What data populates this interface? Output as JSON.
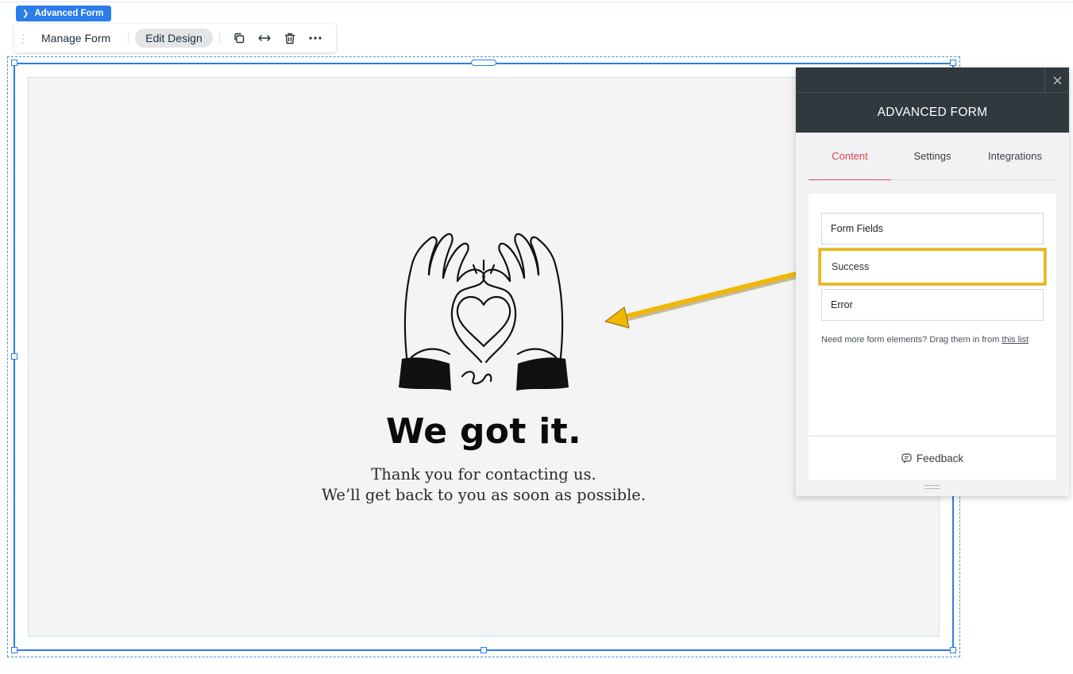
{
  "component_tag": {
    "label": "Advanced Form"
  },
  "toolbar": {
    "manage_label": "Manage Form",
    "edit_design_label": "Edit Design"
  },
  "success_state": {
    "headline": "We got it.",
    "line1": "Thank you for contacting us.",
    "line2": "We’ll get back to you as soon as possible."
  },
  "panel": {
    "title": "ADVANCED FORM",
    "tabs": [
      {
        "label": "Content",
        "active": true
      },
      {
        "label": "Settings",
        "active": false
      },
      {
        "label": "Integrations",
        "active": false
      }
    ],
    "items": [
      {
        "label": "Form Fields"
      },
      {
        "label": "Success",
        "highlighted": true
      },
      {
        "label": "Error"
      }
    ],
    "hint_text": "Need more form elements? Drag them in from ",
    "hint_link": "this list",
    "feedback_label": "Feedback"
  },
  "colors": {
    "selection_blue": "#2b7de9",
    "panel_header": "#30393d",
    "active_tab": "#e0454b",
    "highlight": "#f2b705"
  }
}
